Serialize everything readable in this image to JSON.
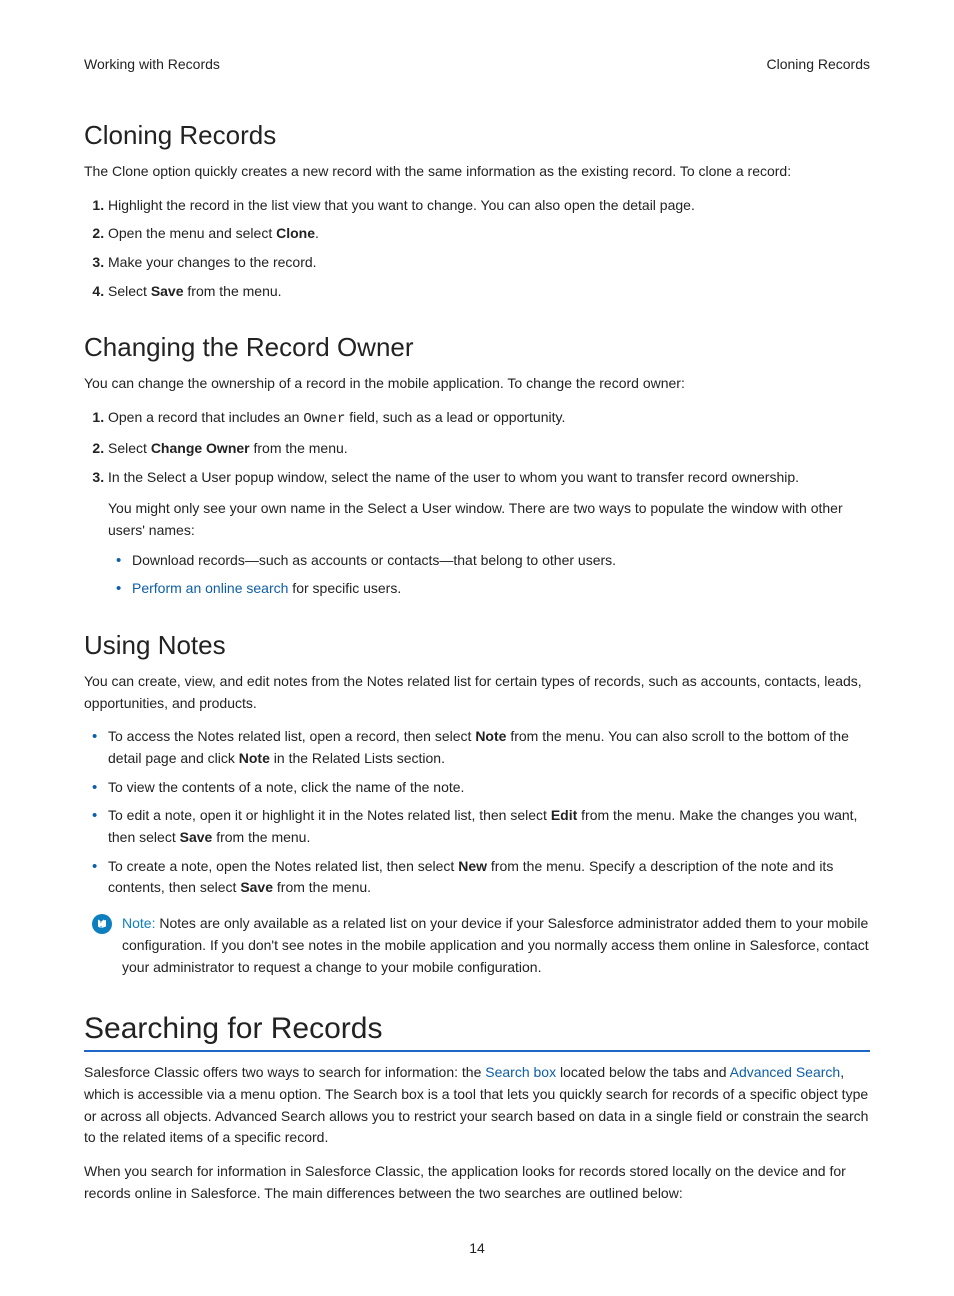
{
  "header": {
    "left": "Working with Records",
    "right": "Cloning Records"
  },
  "cloning": {
    "title": "Cloning Records",
    "intro": "The Clone option quickly creates a new record with the same information as the existing record. To clone a record:",
    "step1": "Highlight the record in the list view that you want to change. You can also open the detail page.",
    "step2_pre": "Open the menu and select ",
    "step2_bold": "Clone",
    "step2_post": ".",
    "step3": "Make your changes to the record.",
    "step4_pre": "Select ",
    "step4_bold": "Save",
    "step4_post": " from the menu."
  },
  "owner": {
    "title": "Changing the Record Owner",
    "intro": "You can change the ownership of a record in the mobile application. To change the record owner:",
    "step1_pre": "Open a record that includes an ",
    "step1_code": "Owner",
    "step1_post": " field, such as a lead or opportunity.",
    "step2_pre": "Select ",
    "step2_bold": "Change Owner",
    "step2_post": " from the menu.",
    "step3": "In the Select a User popup window, select the name of the user to whom you want to transfer record ownership.",
    "step3_sub": "You might only see your own name in the Select a User window. There are two ways to populate the window with other users' names:",
    "sub1": "Download records—such as accounts or contacts—that belong to other users.",
    "sub2_link": "Perform an online search",
    "sub2_post": " for specific users."
  },
  "notes": {
    "title": "Using Notes",
    "intro": "You can create, view, and edit notes from the Notes related list for certain types of records, such as accounts, contacts, leads, opportunities, and products.",
    "b1_pre": "To access the Notes related list, open a record, then select ",
    "b1_bold1": "Note",
    "b1_mid": " from the menu. You can also scroll to the bottom of the detail page and click ",
    "b1_bold2": "Note",
    "b1_post": " in the Related Lists section.",
    "b2": "To view the contents of a note, click the name of the note.",
    "b3_pre": "To edit a note, open it or highlight it in the Notes related list, then select ",
    "b3_bold1": "Edit",
    "b3_mid": " from the menu. Make the changes you want, then select ",
    "b3_bold2": "Save",
    "b3_post": " from the menu.",
    "b4_pre": "To create a note, open the Notes related list, then select ",
    "b4_bold1": "New",
    "b4_mid": " from the menu. Specify a description of the note and its contents, then select ",
    "b4_bold2": "Save",
    "b4_post": " from the menu.",
    "note_label": "Note:",
    "note_body": "  Notes are only available as a related list on your device if your Salesforce administrator added them to your mobile configuration. If you don't see notes in the mobile application and you normally access them online in Salesforce, contact your administrator to request a change to your mobile configuration."
  },
  "searching": {
    "title": "Searching for Records",
    "p1_pre": "Salesforce Classic offers two ways to search for information: the ",
    "p1_link1": "Search box",
    "p1_mid": " located below the tabs and ",
    "p1_link2": "Advanced Search",
    "p1_post": ", which is accessible via a menu option. The Search box is a tool that lets you quickly search for records of a specific object type or across all objects. Advanced Search allows you to restrict your search based on data in a single field or constrain the search to the related items of a specific record.",
    "p2": "When you search for information in Salesforce Classic, the application looks for records stored locally on the device and for records online in Salesforce. The main differences between the two searches are outlined below:"
  },
  "page_number": "14"
}
